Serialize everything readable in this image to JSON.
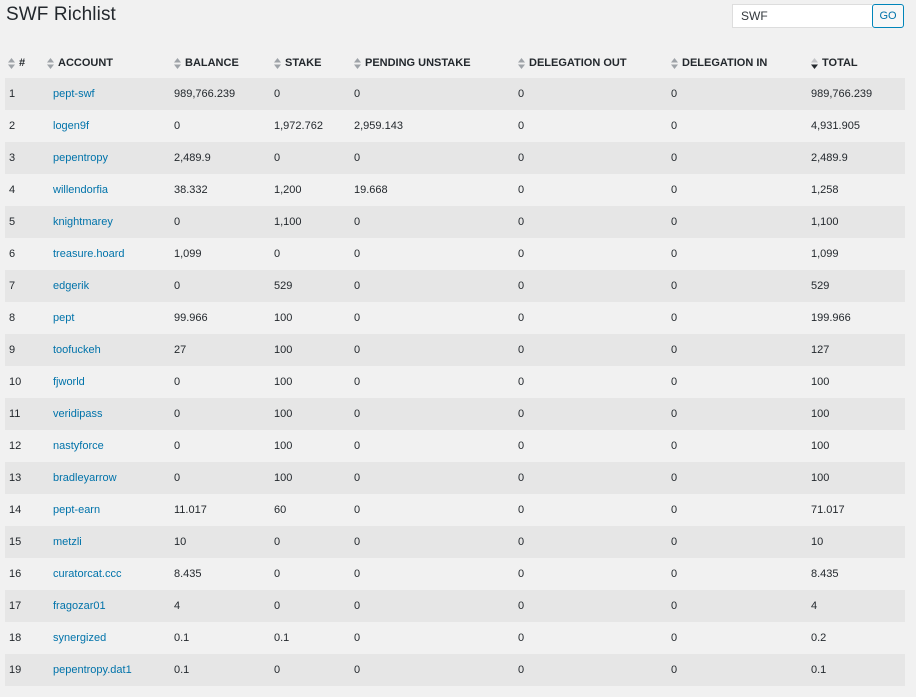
{
  "page": {
    "title": "SWF Richlist"
  },
  "search": {
    "value": "SWF",
    "button_label": "GO"
  },
  "table": {
    "columns": [
      "#",
      "ACCOUNT",
      "BALANCE",
      "STAKE",
      "PENDING UNSTAKE",
      "DELEGATION OUT",
      "DELEGATION IN",
      "TOTAL"
    ],
    "sorted_column": "TOTAL",
    "sort_direction": "desc",
    "rows": [
      [
        "1",
        "pept-swf",
        "989,766.239",
        "0",
        "0",
        "0",
        "0",
        "989,766.239"
      ],
      [
        "2",
        "logen9f",
        "0",
        "1,972.762",
        "2,959.143",
        "0",
        "0",
        "4,931.905"
      ],
      [
        "3",
        "pepentropy",
        "2,489.9",
        "0",
        "0",
        "0",
        "0",
        "2,489.9"
      ],
      [
        "4",
        "willendorfia",
        "38.332",
        "1,200",
        "19.668",
        "0",
        "0",
        "1,258"
      ],
      [
        "5",
        "knightmarey",
        "0",
        "1,100",
        "0",
        "0",
        "0",
        "1,100"
      ],
      [
        "6",
        "treasure.hoard",
        "1,099",
        "0",
        "0",
        "0",
        "0",
        "1,099"
      ],
      [
        "7",
        "edgerik",
        "0",
        "529",
        "0",
        "0",
        "0",
        "529"
      ],
      [
        "8",
        "pept",
        "99.966",
        "100",
        "0",
        "0",
        "0",
        "199.966"
      ],
      [
        "9",
        "toofuckeh",
        "27",
        "100",
        "0",
        "0",
        "0",
        "127"
      ],
      [
        "10",
        "fjworld",
        "0",
        "100",
        "0",
        "0",
        "0",
        "100"
      ],
      [
        "11",
        "veridipass",
        "0",
        "100",
        "0",
        "0",
        "0",
        "100"
      ],
      [
        "12",
        "nastyforce",
        "0",
        "100",
        "0",
        "0",
        "0",
        "100"
      ],
      [
        "13",
        "bradleyarrow",
        "0",
        "100",
        "0",
        "0",
        "0",
        "100"
      ],
      [
        "14",
        "pept-earn",
        "11.017",
        "60",
        "0",
        "0",
        "0",
        "71.017"
      ],
      [
        "15",
        "metzli",
        "10",
        "0",
        "0",
        "0",
        "0",
        "10"
      ],
      [
        "16",
        "curatorcat.ccc",
        "8.435",
        "0",
        "0",
        "0",
        "0",
        "8.435"
      ],
      [
        "17",
        "fragozar01",
        "4",
        "0",
        "0",
        "0",
        "0",
        "4"
      ],
      [
        "18",
        "synergized",
        "0.1",
        "0.1",
        "0",
        "0",
        "0",
        "0.2"
      ],
      [
        "19",
        "pepentropy.dat1",
        "0.1",
        "0",
        "0",
        "0",
        "0",
        "0.1"
      ]
    ]
  },
  "colors": {
    "link": "#0073aa",
    "row_odd": "#e6e6e6",
    "row_even": "#f1f1f1",
    "background": "#f1f1f1"
  },
  "icons": {
    "sortable": "sort-both-icon",
    "sorted_desc": "sort-desc-icon"
  }
}
